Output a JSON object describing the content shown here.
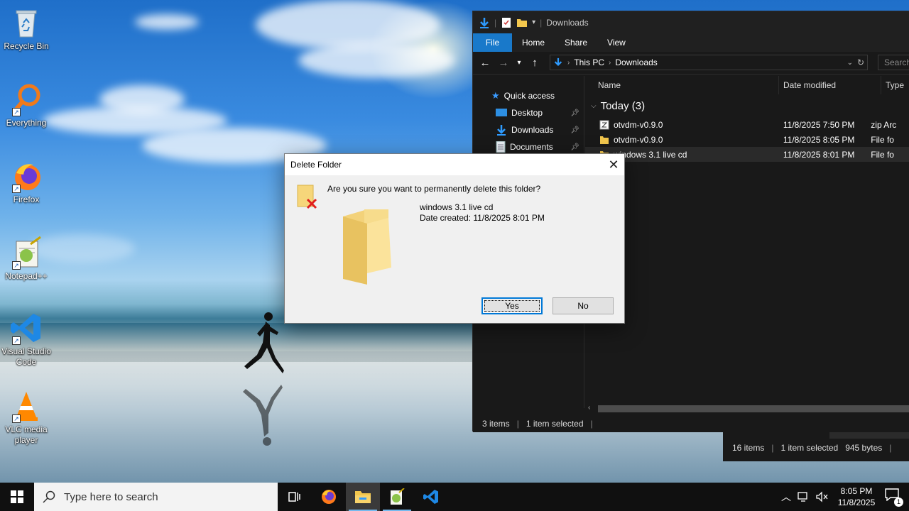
{
  "desktop": {
    "icons": [
      {
        "label": "Recycle Bin",
        "icon": "recycle-bin-icon"
      },
      {
        "label": "Everything",
        "icon": "everything-search-icon"
      },
      {
        "label": "Firefox",
        "icon": "firefox-icon"
      },
      {
        "label": "Notepad++",
        "icon": "notepad-plus-plus-icon"
      },
      {
        "label": "Visual Studio Code",
        "icon": "vscode-icon"
      },
      {
        "label": "VLC media player",
        "icon": "vlc-icon"
      }
    ]
  },
  "explorer": {
    "title": "Downloads",
    "ribbon_tabs": [
      "File",
      "Home",
      "Share",
      "View"
    ],
    "breadcrumb": [
      "This PC",
      "Downloads"
    ],
    "search_placeholder": "Search",
    "nav_items": [
      {
        "label": "Quick access",
        "icon": "star-icon"
      },
      {
        "label": "Desktop",
        "icon": "desktop-folder-icon",
        "pinned": true
      },
      {
        "label": "Downloads",
        "icon": "downloads-icon",
        "pinned": true
      },
      {
        "label": "Documents",
        "icon": "documents-icon",
        "pinned": true
      }
    ],
    "columns": [
      "Name",
      "Date modified",
      "Type"
    ],
    "group": "Today (3)",
    "files": [
      {
        "name": "otvdm-v0.9.0",
        "date": "11/8/2025 7:50 PM",
        "type": "zip Arc",
        "icon": "zip-icon"
      },
      {
        "name": "otvdm-v0.9.0",
        "date": "11/8/2025 8:05 PM",
        "type": "File fo",
        "icon": "folder-icon"
      },
      {
        "name": "windows 3.1 live cd",
        "date": "11/8/2025 8:01 PM",
        "type": "File fo",
        "icon": "folder-icon",
        "selected": true
      }
    ],
    "status": {
      "items": "3 items",
      "selected": "1 item selected"
    }
  },
  "explorer_behind": {
    "status": {
      "items": "16 items",
      "selected": "1 item selected",
      "size": "945 bytes"
    }
  },
  "dialog": {
    "title": "Delete Folder",
    "question": "Are you sure you want to permanently delete this folder?",
    "item_name": "windows 3.1 live cd",
    "date_created": "Date created: 11/8/2025 8:01 PM",
    "yes_label": "Yes",
    "no_label": "No"
  },
  "taskbar": {
    "search_placeholder": "Type here to search",
    "apps": [
      "task-view-icon",
      "firefox-icon",
      "file-explorer-icon",
      "notepad-plus-plus-icon",
      "vscode-icon"
    ],
    "time": "8:05 PM",
    "date": "11/8/2025",
    "notification_count": "1"
  },
  "colors": {
    "accent": "#1979ca",
    "taskbar": "#101010",
    "explorer_bg": "#191919",
    "dialog_bg": "#f0f0f0"
  }
}
